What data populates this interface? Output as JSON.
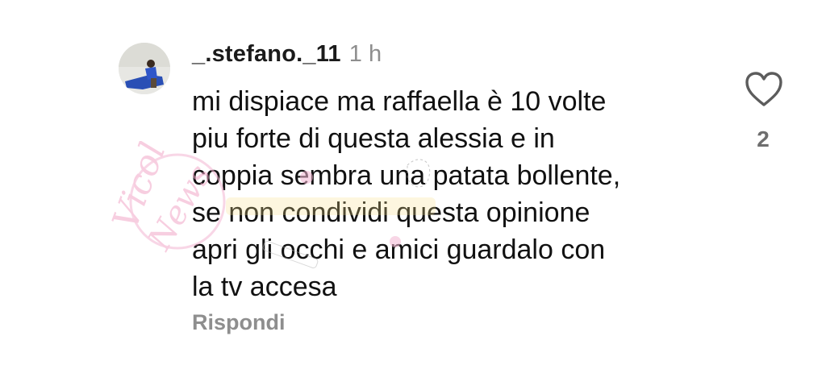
{
  "comment": {
    "username": "_.stefano._11",
    "time": "1 h",
    "text": "mi dispiace ma raffaella è 10 volte\npiu forte di questa alessia e in\ncoppia sembra una patata bollente,\nse non condividi questa opinione\napri gli occhi e amici guardalo con\nla tv accesa",
    "reply_label": "Rispondi",
    "like_count": "2"
  },
  "icons": {
    "like": "heart-icon",
    "avatar": "avatar"
  },
  "watermark": {
    "text": "Vicol… dalle News"
  },
  "colors": {
    "text": "#111111",
    "muted": "#8e8e8e",
    "watermark": "#f2a7c8"
  }
}
